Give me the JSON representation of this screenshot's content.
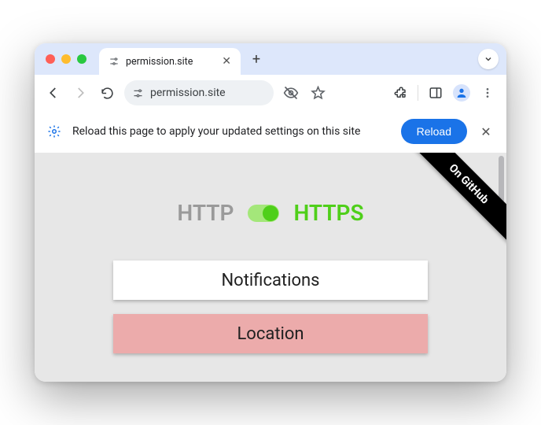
{
  "tab": {
    "title": "permission.site"
  },
  "omnibox": {
    "url": "permission.site"
  },
  "infobar": {
    "message": "Reload this page to apply your updated settings on this site",
    "reload_label": "Reload"
  },
  "ribbon": {
    "label": "On GitHub"
  },
  "protocol": {
    "http": "HTTP",
    "https": "HTTPS",
    "https_active": true
  },
  "buttons": {
    "notifications": "Notifications",
    "location": "Location"
  }
}
